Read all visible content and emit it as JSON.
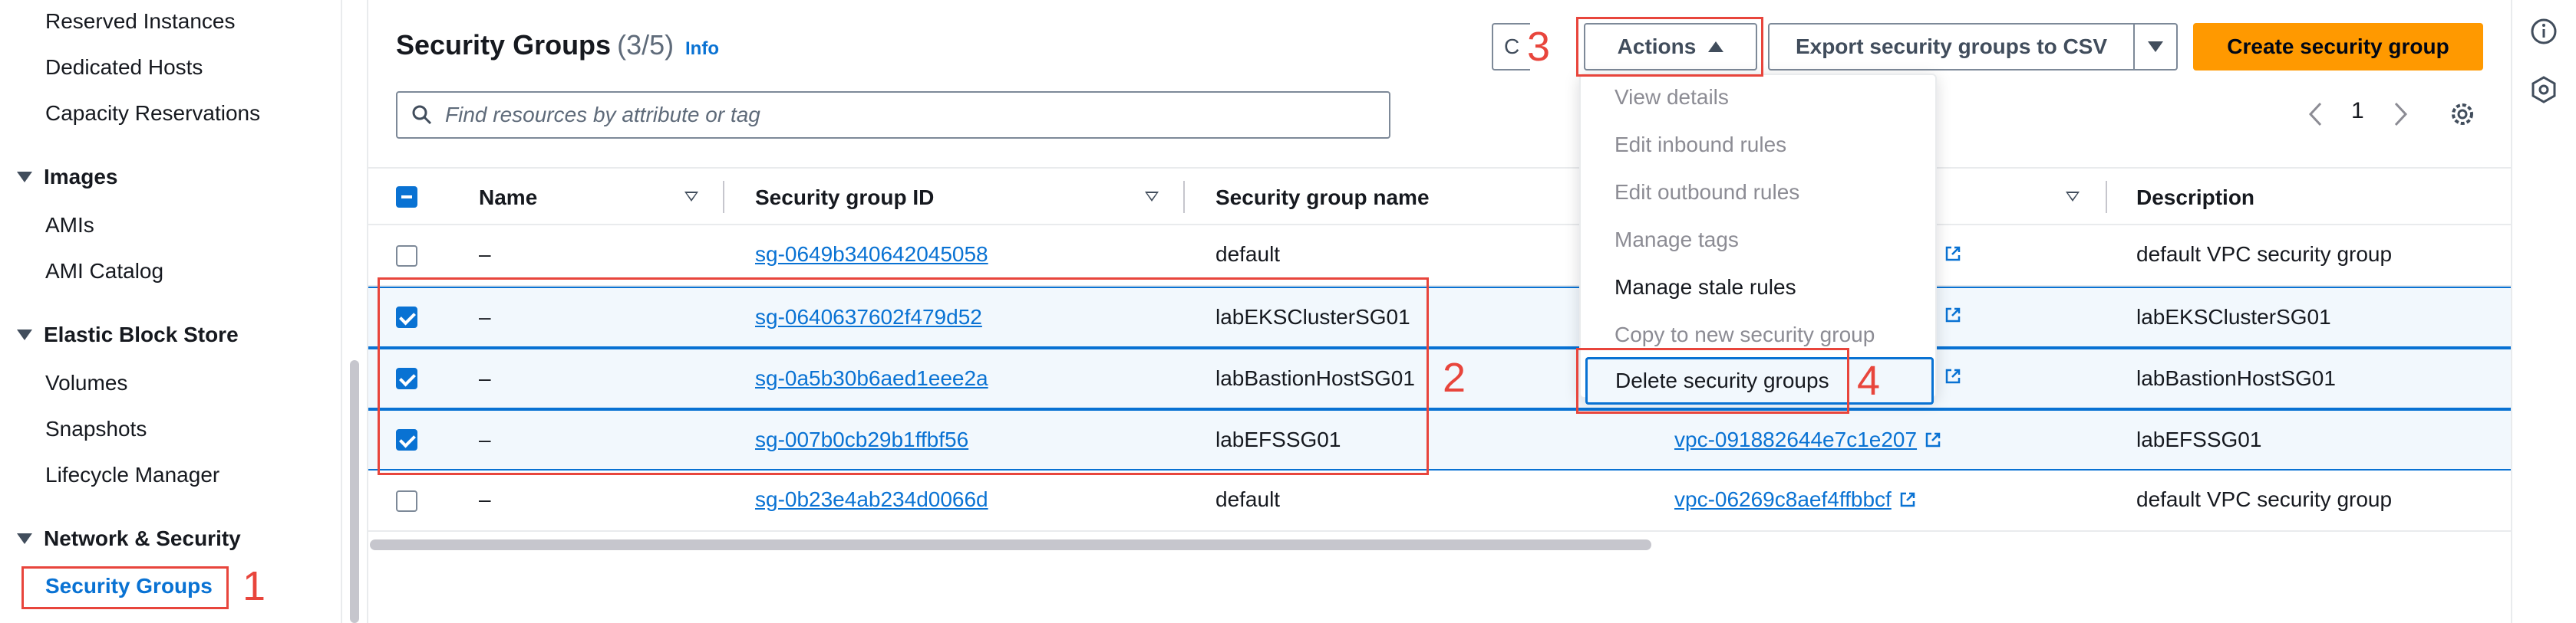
{
  "sidebar": {
    "items": [
      {
        "label": "Reserved Instances",
        "type": "link"
      },
      {
        "label": "Dedicated Hosts",
        "type": "link"
      },
      {
        "label": "Capacity Reservations",
        "type": "link"
      },
      {
        "label": "Images",
        "type": "section"
      },
      {
        "label": "AMIs",
        "type": "link"
      },
      {
        "label": "AMI Catalog",
        "type": "link"
      },
      {
        "label": "Elastic Block Store",
        "type": "section"
      },
      {
        "label": "Volumes",
        "type": "link"
      },
      {
        "label": "Snapshots",
        "type": "link"
      },
      {
        "label": "Lifecycle Manager",
        "type": "link"
      },
      {
        "label": "Network & Security",
        "type": "section"
      },
      {
        "label": "Security Groups",
        "type": "link",
        "active": true
      }
    ]
  },
  "header": {
    "title": "Security Groups",
    "count": "(3/5)",
    "info": "Info",
    "refresh_label": "C",
    "actions_label": "Actions",
    "export_label": "Export security groups to CSV",
    "create_label": "Create security group"
  },
  "search": {
    "placeholder": "Find resources by attribute or tag"
  },
  "pagination": {
    "current_page": "1"
  },
  "table": {
    "columns": [
      "Name",
      "Security group ID",
      "Security group name",
      "Description"
    ],
    "rows": [
      {
        "name": "–",
        "id": "sg-0649b340642045058",
        "group_name": "default",
        "vpc": "",
        "description": "default VPC security group",
        "selected": false
      },
      {
        "name": "–",
        "id": "sg-0640637602f479d52",
        "group_name": "labEKSClusterSG01",
        "vpc": "",
        "description": "labEKSClusterSG01",
        "selected": true
      },
      {
        "name": "–",
        "id": "sg-0a5b30b6aed1eee2a",
        "group_name": "labBastionHostSG01",
        "vpc": "",
        "description": "labBastionHostSG01",
        "selected": true
      },
      {
        "name": "–",
        "id": "sg-007b0cb29b1ffbf56",
        "group_name": "labEFSSG01",
        "vpc": "vpc-091882644e7c1e207",
        "description": "labEFSSG01",
        "selected": true
      },
      {
        "name": "–",
        "id": "sg-0b23e4ab234d0066d",
        "group_name": "default",
        "vpc": "vpc-06269c8aef4ffbbcf",
        "description": "default VPC security group",
        "selected": false
      }
    ]
  },
  "actions_menu": {
    "items": [
      {
        "label": "View details",
        "enabled": false
      },
      {
        "label": "Edit inbound rules",
        "enabled": false
      },
      {
        "label": "Edit outbound rules",
        "enabled": false
      },
      {
        "label": "Manage tags",
        "enabled": false
      },
      {
        "label": "Manage stale rules",
        "enabled": true
      },
      {
        "label": "Copy to new security group",
        "enabled": false
      },
      {
        "label": "Delete security groups",
        "enabled": true,
        "highlighted": true
      }
    ]
  },
  "annotations": {
    "n1": "1",
    "n2": "2",
    "n3": "3",
    "n4": "4"
  },
  "colors": {
    "accent": "#0972d3",
    "primary_button": "#ff9900",
    "annotation": "#e8453c",
    "selected_row_bg": "#f2f8fd"
  }
}
